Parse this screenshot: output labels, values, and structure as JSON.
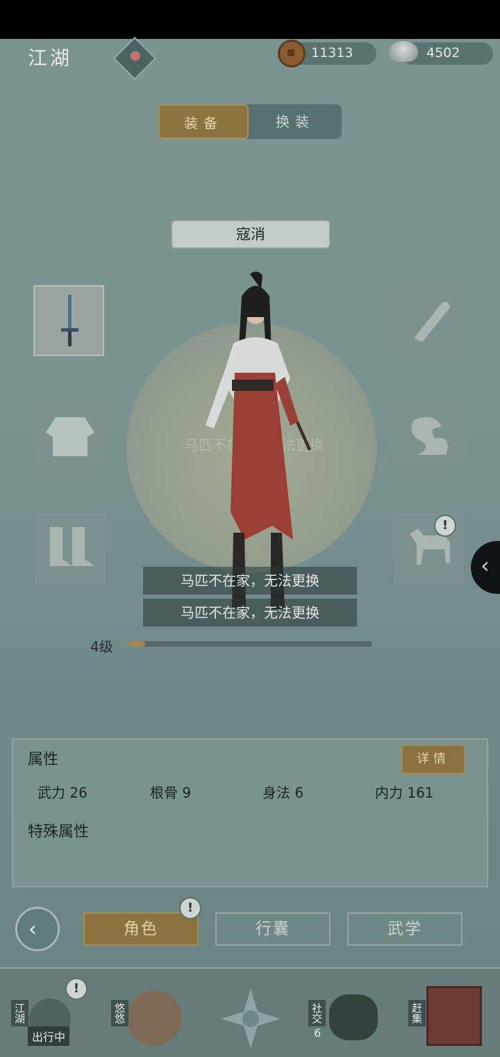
{
  "header": {
    "title": "江湖",
    "copper_coins": "11313",
    "silver": "4502"
  },
  "tabs": [
    {
      "label": "装备",
      "active": true
    },
    {
      "label": "换装",
      "active": false
    }
  ],
  "character": {
    "name": "寇消"
  },
  "slots": {
    "weapon": "sword-icon",
    "armor": "robe-icon",
    "boots": "boots-icon",
    "accessory": "scroll-icon",
    "talisman": "cloud-icon",
    "mount": "horse-icon"
  },
  "toasts": [
    "马匹不在家，无法更换",
    "马匹不在家，无法更换"
  ],
  "ghost_toast": "马匹不在家，无法更换",
  "level": {
    "label": "4级",
    "progress": 0.07
  },
  "attributes": {
    "heading": "属性",
    "detail_label": "详情",
    "stats": [
      {
        "label": "武力",
        "value": "26"
      },
      {
        "label": "根骨",
        "value": "9"
      },
      {
        "label": "身法",
        "value": "6"
      },
      {
        "label": "内力",
        "value": "161"
      }
    ],
    "special_heading": "特殊属性"
  },
  "menu": {
    "role": "角色",
    "bag": "行囊",
    "martial": "武学"
  },
  "bottom_nav": {
    "jianghu": "江湖",
    "jianghu_status": "出行中",
    "youyou": "悠悠",
    "shejiao": "社交",
    "shejiao_badge": "6",
    "ganji": "赶集"
  },
  "colors": {
    "accent_gold": "#8b7340",
    "panel": "#7a9290",
    "robe_red": "#9b3f34"
  }
}
